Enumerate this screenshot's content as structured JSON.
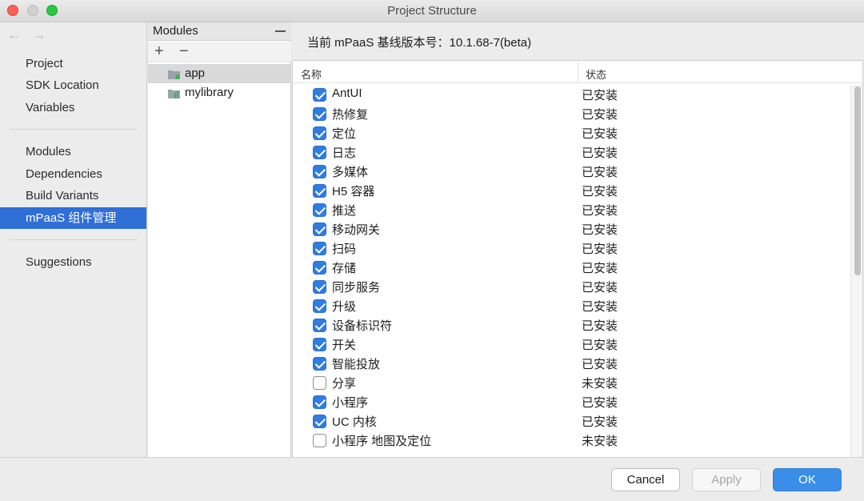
{
  "window": {
    "title": "Project Structure"
  },
  "sidebar": {
    "back_icon": "arrow-left-icon",
    "forward_icon": "arrow-right-icon",
    "items": [
      {
        "label": "Project"
      },
      {
        "label": "SDK Location"
      },
      {
        "label": "Variables"
      },
      {
        "label": "Modules"
      },
      {
        "label": "Dependencies"
      },
      {
        "label": "Build Variants"
      },
      {
        "label": "mPaaS 组件管理",
        "selected": true
      },
      {
        "label": "Suggestions"
      }
    ]
  },
  "modules": {
    "title": "Modules",
    "add_label": "+",
    "remove_label": "−",
    "items": [
      {
        "label": "app",
        "selected": true,
        "icon": "app-module-icon"
      },
      {
        "label": "mylibrary",
        "selected": false,
        "icon": "library-module-icon"
      }
    ]
  },
  "main": {
    "baseline_text": "当前 mPaaS 基线版本号：10.1.68-7(beta)",
    "columns": {
      "name": "名称",
      "status": "状态"
    },
    "components": [
      {
        "name": "AntUI",
        "checked": true,
        "status": "已安装"
      },
      {
        "name": "热修复",
        "checked": true,
        "status": "已安装"
      },
      {
        "name": "定位",
        "checked": true,
        "status": "已安装"
      },
      {
        "name": "日志",
        "checked": true,
        "status": "已安装"
      },
      {
        "name": "多媒体",
        "checked": true,
        "status": "已安装"
      },
      {
        "name": "H5 容器",
        "checked": true,
        "status": "已安装"
      },
      {
        "name": "推送",
        "checked": true,
        "status": "已安装"
      },
      {
        "name": "移动网关",
        "checked": true,
        "status": "已安装"
      },
      {
        "name": "扫码",
        "checked": true,
        "status": "已安装"
      },
      {
        "name": "存储",
        "checked": true,
        "status": "已安装"
      },
      {
        "name": "同步服务",
        "checked": true,
        "status": "已安装"
      },
      {
        "name": "升级",
        "checked": true,
        "status": "已安装"
      },
      {
        "name": "设备标识符",
        "checked": true,
        "status": "已安装"
      },
      {
        "name": "开关",
        "checked": true,
        "status": "已安装"
      },
      {
        "name": "智能投放",
        "checked": true,
        "status": "已安装"
      },
      {
        "name": "分享",
        "checked": false,
        "status": "未安装"
      },
      {
        "name": "小程序",
        "checked": true,
        "status": "已安装"
      },
      {
        "name": "UC 内核",
        "checked": true,
        "status": "已安装"
      },
      {
        "name": "小程序 地图及定位",
        "checked": false,
        "status": "未安装"
      }
    ]
  },
  "footer": {
    "cancel_label": "Cancel",
    "apply_label": "Apply",
    "ok_label": "OK"
  },
  "colors": {
    "accent": "#2f6fd6",
    "checkbox": "#2f7de1",
    "ok_button": "#3b8ee8"
  }
}
